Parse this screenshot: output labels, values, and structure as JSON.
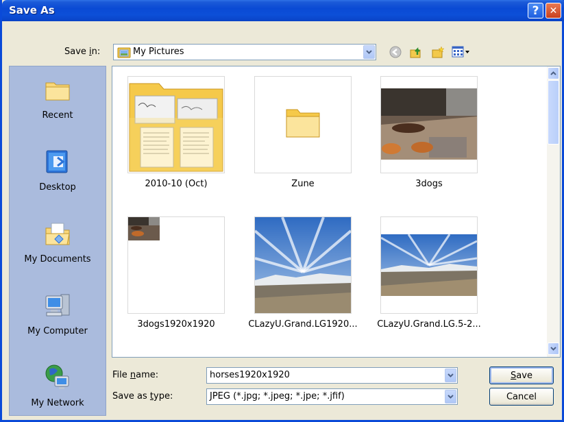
{
  "window": {
    "title": "Save As",
    "help_glyph": "?",
    "close_glyph": "✕"
  },
  "save_in": {
    "label_pre": "Save ",
    "label_accel": "i",
    "label_post": "n:",
    "value": "My Pictures",
    "icon": "my-pictures-folder-icon"
  },
  "toolbar": {
    "back_icon": "back-arrow-icon",
    "up_icon": "up-folder-icon",
    "new_folder_icon": "new-folder-icon",
    "views_icon": "views-menu-icon"
  },
  "places": [
    {
      "label": "Recent",
      "icon": "recent-folder-icon"
    },
    {
      "label": "Desktop",
      "icon": "desktop-icon"
    },
    {
      "label": "My Documents",
      "icon": "my-documents-icon"
    },
    {
      "label": "My Computer",
      "icon": "my-computer-icon"
    },
    {
      "label": "My Network",
      "icon": "my-network-icon"
    }
  ],
  "files": [
    {
      "label": "2010-10 (Oct)",
      "kind": "folder-with-docs"
    },
    {
      "label": "Zune",
      "kind": "folder"
    },
    {
      "label": "3dogs",
      "kind": "photo-dogs"
    },
    {
      "label": "3dogs1920x1920",
      "kind": "photo-small"
    },
    {
      "label": "CLazyU.Grand.LG1920...",
      "kind": "photo-sky-tall"
    },
    {
      "label": "CLazyU.Grand.LG.5-2...",
      "kind": "photo-sky-wide"
    }
  ],
  "file_name": {
    "label_pre": "File ",
    "label_accel": "n",
    "label_post": "ame:",
    "value": "horses1920x1920"
  },
  "save_as_type": {
    "label_pre": "Save as ",
    "label_accel": "t",
    "label_post": "ype:",
    "value": "JPEG (*.jpg; *.jpeg; *.jpe; *.jfif)"
  },
  "buttons": {
    "save_accel": "S",
    "save_rest": "ave",
    "cancel": "Cancel"
  },
  "colors": {
    "title_bar": "#0a4ad4",
    "places_bar": "#aabbdd",
    "dialog_bg": "#ece9d8",
    "close_button": "#c8401d"
  }
}
